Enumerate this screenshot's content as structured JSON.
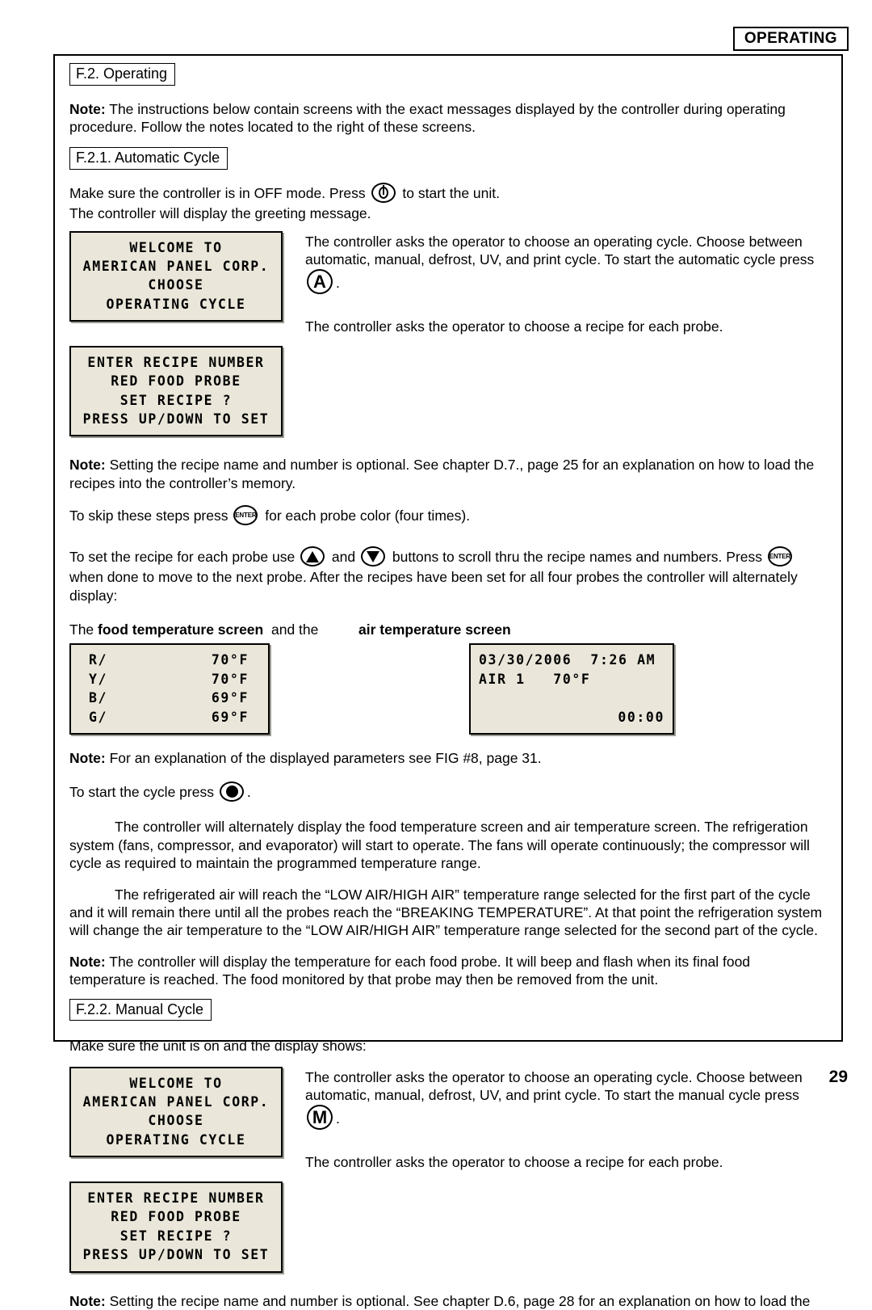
{
  "header": {
    "running_head": "OPERATING"
  },
  "folio": {
    "page_number": "29"
  },
  "sections": {
    "f2": {
      "heading": "F.2. Operating"
    },
    "f21": {
      "heading": "F.2.1. Automatic Cycle"
    },
    "f22": {
      "heading": "F.2.2. Manual Cycle"
    }
  },
  "body": {
    "note_intro_label": "Note:",
    "note_intro": " The instructions below contain screens with the exact messages displayed by the controller during operating procedure. Follow the notes located to the right of these screens.",
    "auto_line1_a": "Make sure the controller is in OFF mode. Press ",
    "auto_line1_b": " to start the unit.",
    "auto_line2": "The controller will display the greeting message.",
    "note_choose_cycle_auto": "The controller asks the operator to choose an operating cycle. Choose between automatic, manual, defrost, UV, and print cycle. To start the automatic cycle press ",
    "note_choose_cycle_auto_end": ".",
    "note_choose_recipe": "The controller asks the operator to choose a recipe for each probe.",
    "note_recipe_label": "Note:",
    "note_recipe_optional": " Setting the recipe name and number is optional. See chapter D.7., page 25 for an explanation on how to load the recipes into the controller’s memory.",
    "skip_steps_a": "To skip these steps press ",
    "skip_steps_b": " for each probe color (four times).",
    "set_recipe_a": "To set the recipe for each probe use ",
    "set_recipe_b": " and ",
    "set_recipe_c": " buttons to scroll thru the recipe names and numbers. Press ",
    "set_recipe_d": " when done to move to the next probe. After the recipes have been set for all four probes the controller will alternately display:",
    "food_screen_lead": "The ",
    "food_screen_label": "food temperature screen",
    "and_the": "and the",
    "air_screen_label": "air temperature screen",
    "note_params_label": "Note:",
    "note_params": " For an explanation of the displayed parameters see FIG #8, page 31.",
    "start_cycle_a": "To start the cycle press ",
    "start_cycle_b": ".",
    "para_alternate": "The controller will alternately display the food temperature screen and air temperature screen. The refrigeration system (fans, compressor, and evaporator) will start to operate. The fans will operate continuously; the compressor will cycle as required to maintain the programmed temperature range.",
    "para_breaking": "The refrigerated air will reach the “LOW AIR/HIGH AIR” temperature range selected for the first part of the cycle and it will remain there until all the probes reach the “BREAKING TEMPERATURE”. At that point the refrigeration system will change the air temperature to the “LOW AIR/HIGH AIR” temperature range selected for the second part of the cycle.",
    "note_probe_label": "Note:",
    "note_probe": " The controller will display the temperature for each food probe. It will beep and flash when its final food temperature is reached. The food monitored by that probe may then be removed from the unit.",
    "manual_unit_on": "Make sure the unit is on and the display shows:",
    "note_choose_cycle_manual": "The controller asks the operator to choose an operating cycle. Choose between automatic, manual, defrost, UV, and print cycle. To start the manual cycle press ",
    "note_choose_cycle_manual_end": ".",
    "note_recipe_optional_manual_label": "Note:",
    "note_recipe_optional_manual": " Setting the recipe name and number is optional. See chapter D.6, page 28 for an explanation on how to load the"
  },
  "keys": {
    "power": {
      "icon": "power-icon",
      "label": ""
    },
    "enter": {
      "icon": "enter-key-icon",
      "label": "ENTER"
    },
    "up": {
      "icon": "up-arrow-icon",
      "label": ""
    },
    "down": {
      "icon": "down-arrow-icon",
      "label": ""
    },
    "start": {
      "icon": "start-dot-icon",
      "label": ""
    },
    "auto": {
      "icon": "letter-a-key-icon",
      "label": "A"
    },
    "manual": {
      "icon": "letter-m-key-icon",
      "label": "M"
    }
  },
  "screens": {
    "welcome": {
      "name": "welcome-screen",
      "lines": [
        "WELCOME TO",
        "AMERICAN PANEL CORP.",
        "CHOOSE",
        "OPERATING CYCLE"
      ]
    },
    "recipe": {
      "name": "enter-recipe-screen",
      "lines": [
        "ENTER RECIPE NUMBER",
        "RED FOOD PROBE",
        "SET RECIPE ?",
        "PRESS UP/DOWN TO SET"
      ]
    },
    "food_temperature": {
      "name": "food-temperature-screen",
      "rows": [
        {
          "probe": "R/",
          "value": "70°F"
        },
        {
          "probe": "Y/",
          "value": "70°F"
        },
        {
          "probe": "B/",
          "value": "69°F"
        },
        {
          "probe": "G/",
          "value": "69°F"
        }
      ]
    },
    "air_temperature": {
      "name": "air-temperature-screen",
      "date": "03/30/2006",
      "time": "7:26 AM",
      "air_label": "AIR 1",
      "air_value": "70°F",
      "elapsed": "00:00"
    },
    "welcome_manual": {
      "name": "welcome-screen-manual",
      "lines": [
        "WELCOME TO",
        "AMERICAN PANEL CORP.",
        "CHOOSE",
        "OPERATING CYCLE"
      ]
    },
    "recipe_manual": {
      "name": "enter-recipe-screen-manual",
      "lines": [
        "ENTER RECIPE NUMBER",
        "RED FOOD PROBE",
        "SET RECIPE ?",
        "PRESS UP/DOWN TO SET"
      ]
    }
  },
  "colors": {
    "lcd_background": "#eae7da",
    "ink": "#000000",
    "paper": "#ffffff"
  }
}
